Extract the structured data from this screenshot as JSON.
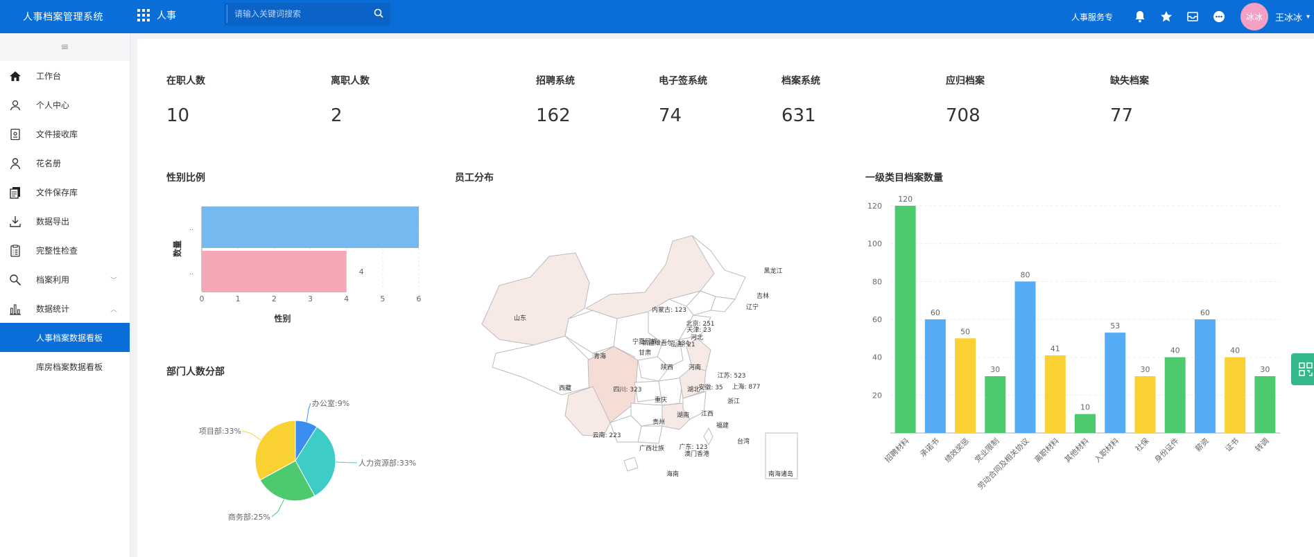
{
  "header": {
    "app_title": "人事档案管理系统",
    "app_switch_label": "人事",
    "search_placeholder": "请输入关键词搜索",
    "service_link": "人事服务专",
    "avatar_text": "冰冰",
    "user_name": "王冰冰",
    "brand_color": "#0a6ed8"
  },
  "sidebar": {
    "items": [
      {
        "label": "工作台",
        "icon": "home-icon"
      },
      {
        "label": "个人中心",
        "icon": "user-icon"
      },
      {
        "label": "文件接收库",
        "icon": "file-receive-icon"
      },
      {
        "label": "花名册",
        "icon": "roster-icon"
      },
      {
        "label": "文件保存库",
        "icon": "file-store-icon"
      },
      {
        "label": "数据导出",
        "icon": "download-icon"
      },
      {
        "label": "完整性检查",
        "icon": "checklist-icon"
      },
      {
        "label": "档案利用",
        "icon": "search-icon"
      },
      {
        "label": "数据统计",
        "icon": "stats-icon"
      },
      {
        "label": "人事档案数据看板",
        "icon": ""
      },
      {
        "label": "库房档案数据看板",
        "icon": ""
      }
    ]
  },
  "stats": [
    {
      "label": "在职人数",
      "value": "10"
    },
    {
      "label": "离职人数",
      "value": "2"
    },
    {
      "label": "招聘系统",
      "value": "162"
    },
    {
      "label": "电子签系统",
      "value": "74"
    },
    {
      "label": "档案系统",
      "value": "631"
    },
    {
      "label": "应归档案",
      "value": "708"
    },
    {
      "label": "缺失档案",
      "value": "77"
    }
  ],
  "sections": {
    "gender_title": "性别比例",
    "dept_title": "部门人数分部",
    "map_title": "员工分布",
    "category_title": "一级类目档案数量"
  },
  "chart_data": [
    {
      "type": "bar",
      "orientation": "horizontal",
      "categories": [
        "..",
        ".."
      ],
      "values": [
        6,
        4
      ],
      "colors": [
        "#74b9ef",
        "#f5a7b5"
      ],
      "data_labels": [
        "",
        "4"
      ],
      "xlabel": "性别",
      "ylabel": "数量",
      "xlim": [
        0,
        6
      ],
      "xticks": [
        0,
        1,
        2,
        3,
        4,
        5,
        6
      ]
    },
    {
      "type": "pie",
      "labels": [
        "办公室:9%",
        "人力资源部:33%",
        "商务部:25%",
        "项目部:33%"
      ],
      "values": [
        9,
        33,
        25,
        33
      ],
      "colors": [
        "#3b8ef0",
        "#3ecdc6",
        "#4dc96e",
        "#fad133"
      ]
    },
    {
      "type": "bar",
      "categories": [
        "招聘材料",
        "承诺书",
        "绩效奖惩",
        "党业限制",
        "劳动合同及相关协议",
        "离职材料",
        "其他材料",
        "入职材料",
        "社保",
        "身份证件",
        "薪资",
        "证书",
        "转调"
      ],
      "values": [
        120,
        60,
        50,
        30,
        80,
        41,
        10,
        53,
        30,
        40,
        60,
        40,
        30
      ],
      "colors": [
        "#4dc96e",
        "#56acf4",
        "#fad133",
        "#4dc96e",
        "#56acf4",
        "#fad133",
        "#4dc96e",
        "#56acf4",
        "#fad133",
        "#4dc96e",
        "#56acf4",
        "#fad133",
        "#4dc96e"
      ],
      "ylim": [
        0,
        120
      ],
      "yticks": [
        20,
        40,
        60,
        80,
        100,
        120
      ]
    }
  ],
  "map": {
    "labels": [
      "黑龙江",
      "吉林",
      "辽宁",
      "内蒙古: 123",
      "北京: 251",
      "天津: 23",
      "河北",
      "山西: 21",
      "山东",
      "新疆维吾尔: 134",
      "宁夏回族",
      "甘肃",
      "青海",
      "陕西",
      "河南",
      "江苏: 523",
      "安徽: 35",
      "上海: 877",
      "湖北",
      "浙江",
      "四川: 323",
      "重庆",
      "西藏",
      "湖南",
      "江西",
      "贵州",
      "福建",
      "云南: 223",
      "广西壮族",
      "广东: 123",
      "澳门香港",
      "台湾",
      "海南",
      "南海诸岛"
    ]
  }
}
